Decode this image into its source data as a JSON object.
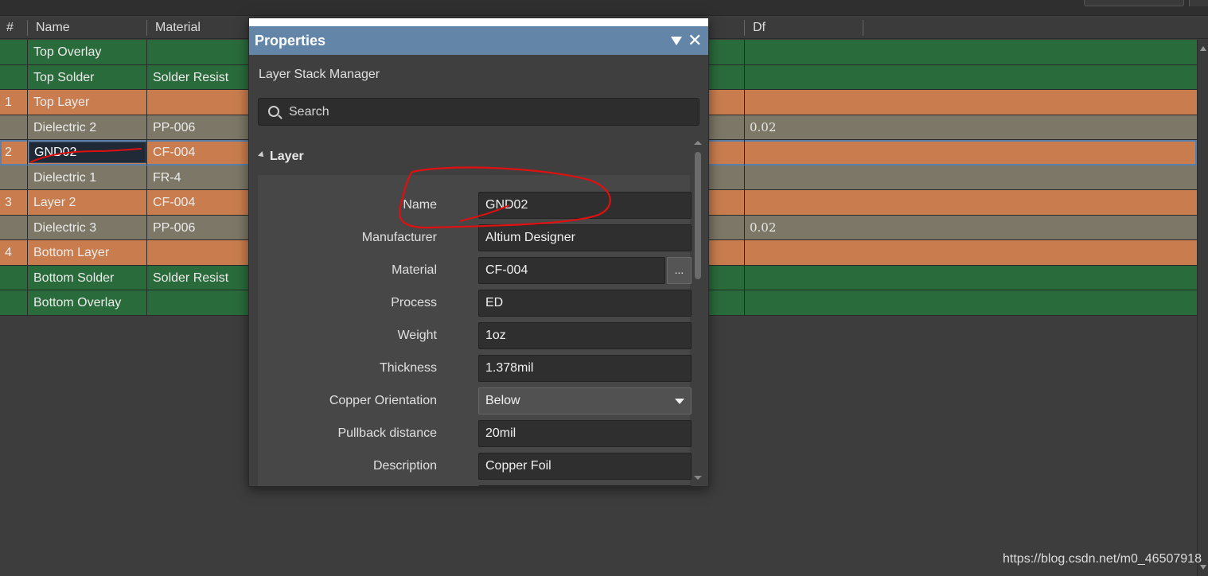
{
  "table": {
    "columns": {
      "num": "#",
      "name": "Name",
      "material": "Material",
      "df": "Df"
    },
    "rows": [
      {
        "num": "",
        "name": "Top Overlay",
        "material": "",
        "df": "",
        "kind": "green"
      },
      {
        "num": "",
        "name": "Top Solder",
        "material": "Solder Resist",
        "df": "",
        "kind": "green"
      },
      {
        "num": "1",
        "name": "Top Layer",
        "material": "",
        "df": "",
        "kind": "orange"
      },
      {
        "num": "",
        "name": "Dielectric 2",
        "material": "PP-006",
        "df": "0.02",
        "kind": "grey"
      },
      {
        "num": "2",
        "name": "GND02",
        "material": "CF-004",
        "df": "",
        "kind": "selected"
      },
      {
        "num": "",
        "name": "Dielectric 1",
        "material": "FR-4",
        "df": "",
        "kind": "grey"
      },
      {
        "num": "3",
        "name": "Layer 2",
        "material": "CF-004",
        "df": "",
        "kind": "orange"
      },
      {
        "num": "",
        "name": "Dielectric 3",
        "material": "PP-006",
        "df": "0.02",
        "kind": "grey"
      },
      {
        "num": "4",
        "name": "Bottom Layer",
        "material": "",
        "df": "",
        "kind": "orange"
      },
      {
        "num": "",
        "name": "Bottom Solder",
        "material": "Solder Resist",
        "df": "",
        "kind": "green"
      },
      {
        "num": "",
        "name": "Bottom Overlay",
        "material": "",
        "df": "",
        "kind": "green"
      }
    ]
  },
  "dialog": {
    "title": "Properties",
    "subtitle": "Layer Stack Manager",
    "search_placeholder": "Search",
    "section": "Layer",
    "fields": {
      "name": {
        "label": "Name",
        "value": "GND02"
      },
      "manufacturer": {
        "label": "Manufacturer",
        "value": "Altium Designer"
      },
      "material": {
        "label": "Material",
        "value": "CF-004"
      },
      "process": {
        "label": "Process",
        "value": "ED"
      },
      "weight": {
        "label": "Weight",
        "value": "1oz"
      },
      "thickness": {
        "label": "Thickness",
        "value": "1.378mil"
      },
      "orientation": {
        "label": "Copper Orientation",
        "value": "Below"
      },
      "pullback": {
        "label": "Pullback distance",
        "value": "20mil"
      },
      "description": {
        "label": "Description",
        "value": "Copper Foil"
      }
    },
    "material_browse": "...",
    "close_glyph": "✕"
  },
  "watermark": "https://blog.csdn.net/m0_46507918",
  "colors": {
    "green_row": "#2a6b3b",
    "orange_row": "#c97d4e",
    "grey_row": "#7c7766",
    "title_bar": "#6386a8",
    "annotation": "#e01010"
  }
}
